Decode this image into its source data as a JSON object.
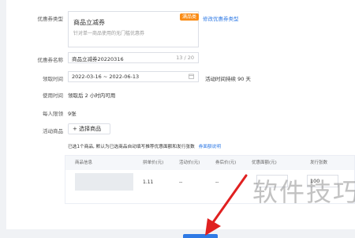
{
  "form": {
    "coupon_type": {
      "label": "优惠券类型",
      "card_title": "商品立减券",
      "card_desc": "针对单一商品使用的无门槛优惠券",
      "badge": "满品类",
      "modify_link": "修改优惠券类型"
    },
    "coupon_name": {
      "label": "优惠券名称",
      "value": "商品立减券20220316",
      "counter": "13 / 20"
    },
    "claim_time": {
      "label": "领取时间",
      "value": "2022-03-16 ~ 2022-06-13",
      "suffix": "活动时间持续 90 天"
    },
    "use_time": {
      "label": "使用时间",
      "value": "领取后 2 小时内可用"
    },
    "limit": {
      "label": "每人限领",
      "value": "9张"
    },
    "products": {
      "label": "活动商品",
      "select_button": "+ 选择商品",
      "note": "已选1个商品, 默认为已选商品自动填写推荐优惠面额和发行张数",
      "note_link": "券面额说明"
    }
  },
  "table": {
    "headers": [
      "商品信息",
      "拼单价(元)",
      "活动价(元)",
      "券后价(元)",
      "优惠面额(元)",
      "发行张数"
    ],
    "row": {
      "price": "1.11",
      "activity_price": "--",
      "after_coupon_price": "--",
      "discount_amount": "",
      "quantity": "100"
    }
  },
  "watermark": "软件技巧",
  "colors": {
    "accent": "#2f7ae5",
    "badge": "#fa8c16",
    "arrow": "#e02020"
  }
}
